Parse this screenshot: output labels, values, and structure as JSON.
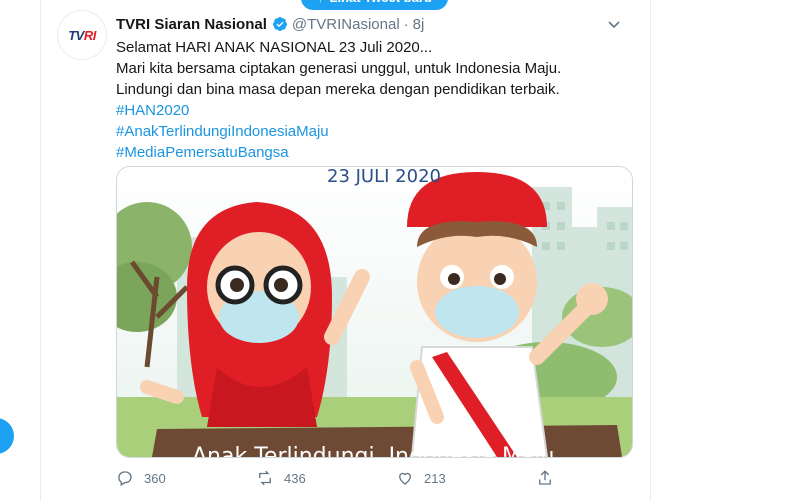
{
  "new_tweets_pill": {
    "arrow": "↑",
    "label": "Lihat Tweet baru"
  },
  "tweet": {
    "avatar_text_a": "TV",
    "avatar_text_b": "RI",
    "author_name": "TVRI Siaran Nasional",
    "handle": "@TVRINasional",
    "separator": "·",
    "time": "8j",
    "lines": [
      "Selamat HARI ANAK NASIONAL 23 Juli 2020...",
      "Mari kita bersama ciptakan generasi unggul, untuk Indonesia Maju.",
      "Lindungi dan bina masa depan mereka dengan pendidikan terbaik."
    ],
    "hashtags": [
      "#HAN2020",
      "#AnakTerlindungiIndonesiaMaju",
      "#MediaPemersatuBangsa"
    ],
    "media": {
      "date_text": "23 JULI 2020",
      "banner_text": "Anak Terlindungi, Indonesia Maju"
    },
    "actions": {
      "reply_count": "360",
      "retweet_count": "436",
      "like_count": "213"
    }
  },
  "colors": {
    "accent": "#1da1f2",
    "link": "#1b95e0",
    "text": "#14171a",
    "muted": "#657786"
  }
}
